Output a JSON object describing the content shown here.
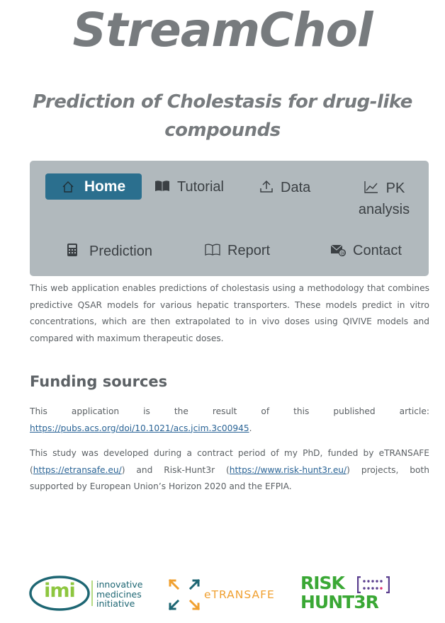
{
  "header": {
    "title": "StreamChol",
    "subtitle": "Prediction of Cholestasis for drug-like compounds"
  },
  "nav": {
    "home": "Home",
    "tutorial": "Tutorial",
    "data": "Data",
    "pk_line1": "PK",
    "pk_line2": "analysis",
    "prediction": "Prediction",
    "report": "Report",
    "contact": "Contact"
  },
  "intro": "This web application enables predictions of cholestasis using a methodology that combines predictive QSAR models for various hepatic transporters. These models predict in vitro concentrations, which are then extrapolated to in vivo doses using QIVIVE models and compared with maximum therapeutic doses.",
  "funding": {
    "heading": "Funding sources",
    "p1_text": "This application is the result of this published article:",
    "p1_link": "https://pubs.acs.org/doi/10.1021/acs.jcim.3c00945",
    "p1_end": ".",
    "p2_a": "This study was developed during a contract period of my PhD, funded by eTRANSAFE (",
    "p2_link1": "https://etransafe.eu/",
    "p2_b": ") and Risk-Hunt3r (",
    "p2_link2": "https://www.risk-hunt3r.eu/",
    "p2_c": ") projects, both supported by European Union’s Horizon 2020 and the EFPIA."
  },
  "logos": {
    "imi_mark": "imi",
    "imi_line1": "innovative",
    "imi_line2": "medicines",
    "imi_line3": "initiative",
    "etransafe": "eTRANSAFE",
    "risk": "RISK",
    "hunt": "HUNT3R"
  },
  "colors": {
    "nav_bg": "#b1b9bd",
    "active_tab": "#2b6f8e",
    "link": "#2a6496",
    "imi_green": "#8dc63f",
    "etransafe_orange": "#f0a030",
    "risk_green": "#3aa835"
  }
}
